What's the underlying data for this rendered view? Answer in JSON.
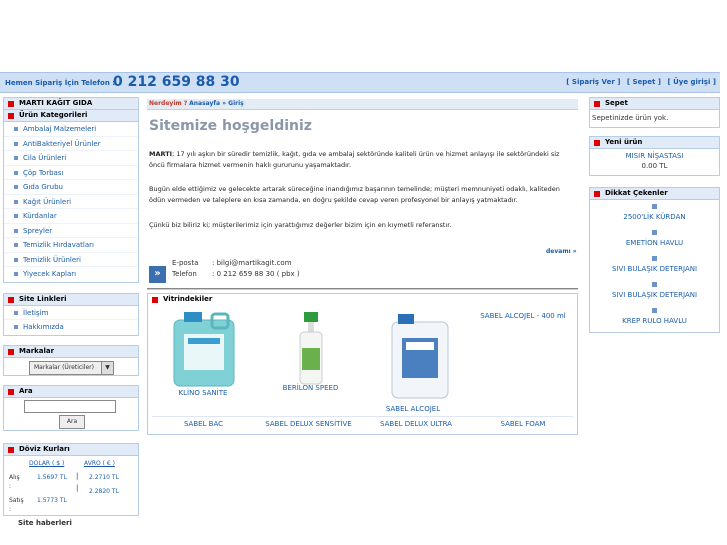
{
  "header": {
    "phone_label": "Hemen Sipariş İçin Telefon :",
    "phone": "0 212 659 88 30",
    "links": [
      "[ Sipariş Ver ]",
      "[ Sepet ]",
      "[ Üye girişi ]"
    ]
  },
  "left": {
    "brand": "MARTI KAĞIT GIDA",
    "categories_title": "Ürün Kategorileri",
    "categories": [
      "Ambalaj Malzemeleri",
      "AntiBakteriyel Ürünler",
      "Cila Ürünleri",
      "Çöp Torbası",
      "Gıda Grubu",
      "Kağıt Ürünleri",
      "Kürdanlar",
      "Spreyler",
      "Temizlik Hırdavatları",
      "Temizlik Ürünleri",
      "Yiyecek Kapları"
    ],
    "site_links_title": "Site Linkleri",
    "site_links": [
      "İletişim",
      "Hakkımızda"
    ],
    "brands_title": "Markalar",
    "brands_select": "Markalar (Üreticiler)",
    "search_title": "Ara",
    "search_button": "Ara",
    "currency_title": "Döviz Kurları",
    "currency_cols": [
      "DOLAR ( $ )",
      "AVRO ( € )"
    ],
    "buy_label": "Alış",
    "sell_label": "Satış",
    "usd_buy": "1.5697 TL",
    "eur_buy": "2.2710 TL",
    "eur_sell": "2.2820 TL",
    "usd_sell": "1.5773 TL",
    "news_title": "Site haberleri"
  },
  "center": {
    "breadcrumb_here": "Nerdeyim ?",
    "breadcrumb_home": "Anasayfa",
    "breadcrumb_sep": " » ",
    "breadcrumb_page": "Giriş",
    "welcome": "Sitemize hoşgeldiniz",
    "p1_bold": "MARTI",
    "p1": "; 17 yılı aşkın bir süredir temizlik, kağıt, gıda ve ambalaj sektöründe kaliteli ürün ve hizmet anlayışı ile sektöründeki siz öncü firmalara hizmet vermenin haklı gururunu yaşamaktadır.",
    "p2": "Bugün elde ettiğimiz ve gelecekte artarak süreceğine inandığımız başarının temelinde; müşteri memnuniyeti odaklı, kaliteden ödün vermeden ve taleplere en kısa zamanda, en doğru şekilde cevap veren profesyonel bir anlayış yatmaktadır.",
    "p3": "Çünkü biz biliriz ki; müşterilerimiz için yarattığımız değerler bizim için en kıymetli referanstır.",
    "more": "devamı »",
    "email_label": "E-posta",
    "email": ": bilgi@martikagit.com",
    "phone_label": "Telefon",
    "phone": ": 0 212 659 88 30 ( pbx )",
    "showcase_title": "Vitrindekiler",
    "products": [
      "KLİNO SANİTE",
      "BERİLON SPEED",
      "SABEL ALCOJEL",
      "SABEL ALCOJEL - 400 ml"
    ],
    "bottom_products": [
      "SABEL BAC",
      "SABEL DELUX SENSİTİVE",
      "SABEL DELUX ULTRA",
      "SABEL FOAM"
    ]
  },
  "right": {
    "cart_title": "Sepet",
    "cart_text": "Sepetinizde ürün yok.",
    "new_title": "Yeni ürün",
    "new_name": "MISIR NİŞASTASI",
    "new_price": "0.00 TL",
    "featured_title": "Dikkat Çekenler",
    "featured": [
      "2500'LİK KÜRDAN",
      "EMETİON HAVLU",
      "SIVI BULAŞIK DETERJANI",
      "SIVI BULAŞIK DETERJANI",
      "KREP RULO HAVLU"
    ]
  },
  "colors": {
    "accent": "#1a5cab",
    "header_bg": "#cfe0f5",
    "marker": "#dd0000"
  }
}
